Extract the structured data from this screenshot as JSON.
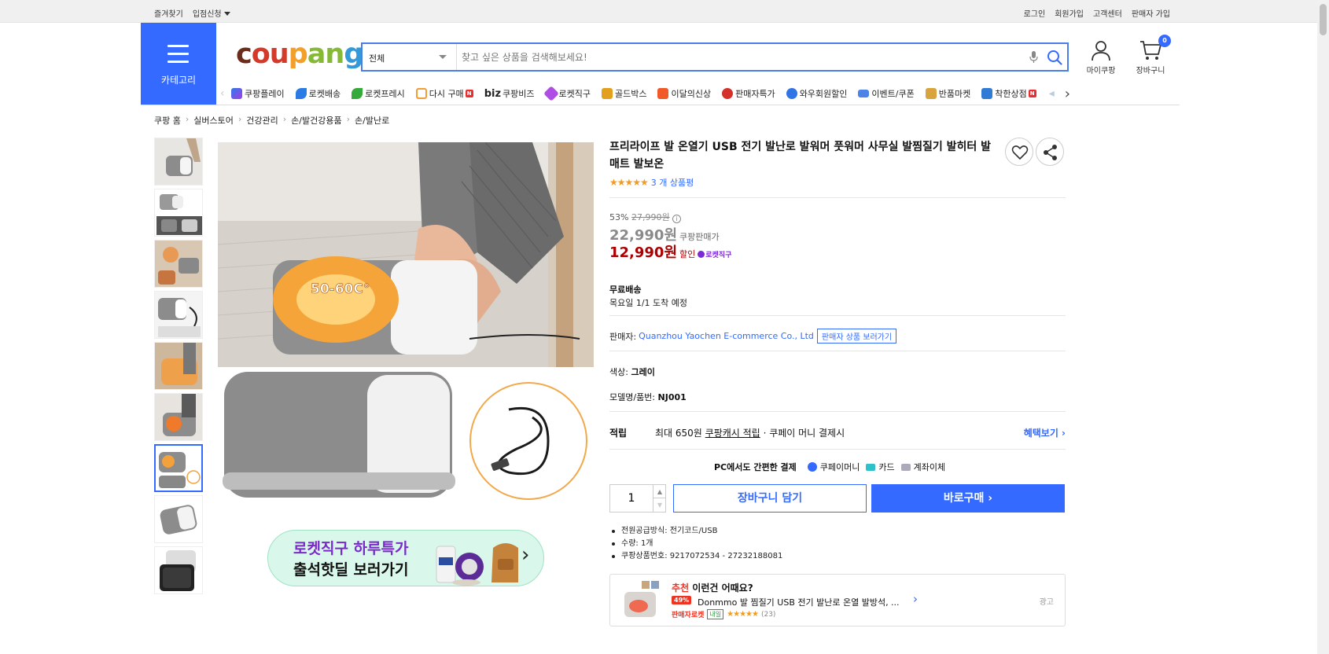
{
  "topbar": {
    "bookmark": "즐겨찾기",
    "vendor_apply": "입점신청",
    "login": "로그인",
    "signup": "회원가입",
    "customer_center": "고객센터",
    "seller_signup": "판매자 가입"
  },
  "header": {
    "category_label": "카테고리",
    "logo_text": [
      "c",
      "ou",
      "p",
      "an",
      "g"
    ],
    "search_category": "전체",
    "search_placeholder": "찾고 싶은 상품을 검색해보세요!",
    "mycoupang": "마이쿠팡",
    "cart": "장바구니",
    "cart_count": "0"
  },
  "nav": {
    "items": [
      {
        "label": "쿠팡플레이",
        "color": "#6a39d9",
        "new": false
      },
      {
        "label": "로켓배송",
        "color": "#2a7be4",
        "new": false
      },
      {
        "label": "로켓프레시",
        "color": "#35a93a",
        "new": false
      },
      {
        "label": "다시 구매",
        "color": "#f29d38",
        "new": true
      },
      {
        "label": "쿠팡비즈",
        "color": "#ffffff",
        "new": false,
        "prefix": "biz"
      },
      {
        "label": "로켓직구",
        "color": "#b04de5",
        "new": false
      },
      {
        "label": "골드박스",
        "color": "#e3a01e",
        "new": false
      },
      {
        "label": "이달의신상",
        "color": "#f05a28",
        "new": false
      },
      {
        "label": "판매자특가",
        "color": "#d3312a",
        "new": false
      },
      {
        "label": "와우회원할인",
        "color": "#3174e6",
        "new": false
      },
      {
        "label": "이벤트/쿠폰",
        "color": "#4c83e8",
        "new": false
      },
      {
        "label": "반품마켓",
        "color": "#d9a33d",
        "new": false
      },
      {
        "label": "착한상점",
        "color": "#2f7bd5",
        "new": true
      }
    ]
  },
  "breadcrumb": [
    "쿠팡 홈",
    "실버스토어",
    "건강관리",
    "손/발건강용품",
    "손/발난로"
  ],
  "main_image": {
    "temp_label": "50-60C°"
  },
  "promo": {
    "line1": "로켓직구 하루특가",
    "line2": "출석핫딜 보러가기"
  },
  "product": {
    "title": "프리라이프 발 온열기 USB 전기 발난로 발워머 풋워머 사무실 발찜질기 발히터 발매트 발보온",
    "stars": "★★★★★",
    "review_count": "3 개 상품평",
    "rating_value": 5,
    "discount_rate": "53%",
    "original_price": "27,990원",
    "sale_price": "22,990원",
    "sale_price_label": "쿠팡판매가",
    "final_price": "12,990원",
    "final_price_label": "할인",
    "rocket_direct": "로켓직구",
    "shipping_title": "무료배송",
    "shipping_eta": "목요일 1/1 도착 예정",
    "seller_label": "판매자:",
    "seller_name": "Quanzhou Yaochen E-commerce Co., Ltd",
    "seller_button": "판매자 상품 보러가기",
    "color_label": "색상:",
    "color_value": "그레이",
    "model_label": "모델명/품번:",
    "model_value": "NJ001",
    "reward_label": "적립",
    "reward_text1": "최대 650원",
    "reward_text2": "쿠팡캐시 적립",
    "reward_text3": "· 쿠페이 머니 결제시",
    "reward_more": "혜택보기 ›",
    "pay_title": "PC에서도 간편한 결제",
    "pay_coupay": "쿠페이머니",
    "pay_card": "카드",
    "pay_bank": "계좌이체",
    "quantity": "1",
    "add_to_cart": "장바구니 담기",
    "buy_now": "바로구매 ›",
    "specs": [
      "전원공급방식: 전기코드/USB",
      "수량: 1개",
      "쿠팡상품번호: 9217072534 - 27232188081"
    ]
  },
  "recommend": {
    "prefix": "추천",
    "heading": "이런건 어때요?",
    "discount": "49%",
    "name": "Donmmo 발 찜질기 USB 전기 발난로 온열 발방석, ...",
    "rocket": "판매자로켓",
    "tomorrow": "내일",
    "stars": "★★★★★",
    "count": "(23)",
    "ad": "광고"
  }
}
